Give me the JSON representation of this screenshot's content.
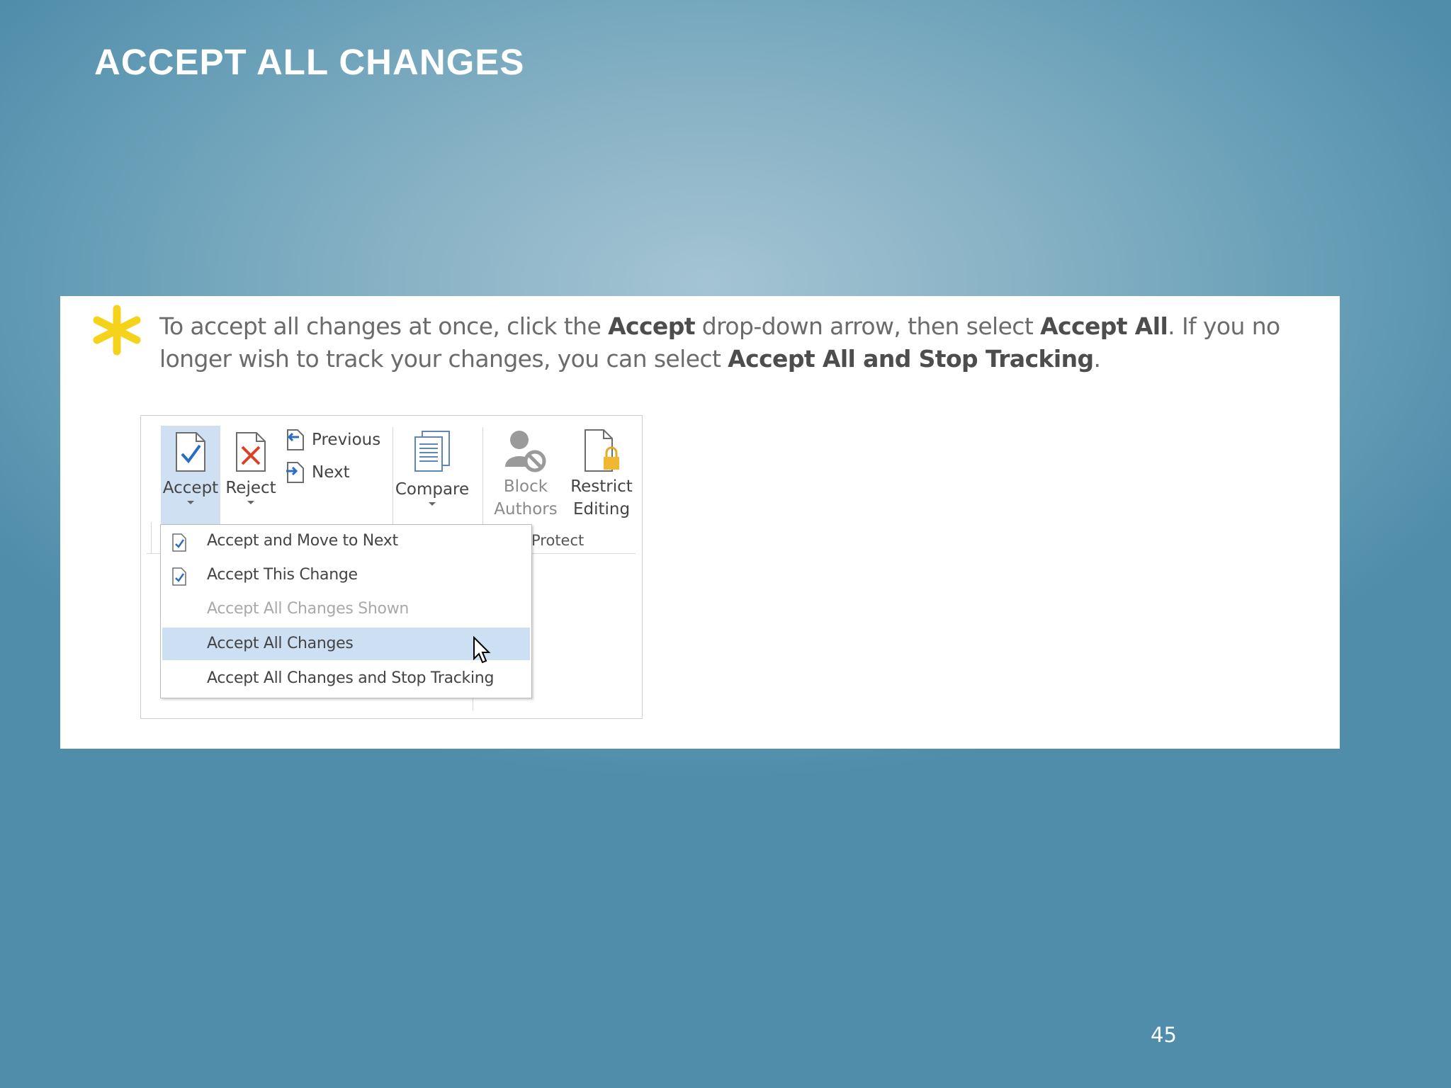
{
  "slide": {
    "title": "ACCEPT ALL CHANGES",
    "page_number": "45"
  },
  "tip": {
    "segments": [
      {
        "text": "To accept all changes at once, click the ",
        "bold": false
      },
      {
        "text": "Accept",
        "bold": true
      },
      {
        "text": " drop-down arrow, then select ",
        "bold": false
      },
      {
        "text": "Accept All",
        "bold": true
      },
      {
        "text": ". If you no longer wish to track your changes, you can select ",
        "bold": false
      },
      {
        "text": "Accept All and Stop Tracking",
        "bold": true
      },
      {
        "text": ".",
        "bold": false
      }
    ]
  },
  "ribbon": {
    "accept_label": "Accept",
    "reject_label": "Reject",
    "previous_label": "Previous",
    "next_label": "Next",
    "compare_label": "Compare",
    "block_label_1": "Block",
    "block_label_2": "Authors",
    "restrict_label_1": "Restrict",
    "restrict_label_2": "Editing",
    "protect_group": "Protect"
  },
  "menu": {
    "items": [
      {
        "label": "Accept and Move to Next",
        "icon": "accept-doc-icon",
        "state": "normal"
      },
      {
        "label": "Accept This Change",
        "icon": "accept-doc-icon",
        "state": "normal"
      },
      {
        "label": "Accept All Changes Shown",
        "icon": "",
        "state": "disabled"
      },
      {
        "label": "Accept All Changes",
        "icon": "",
        "state": "selected"
      },
      {
        "label": "Accept All Changes and Stop Tracking",
        "icon": "",
        "state": "normal"
      }
    ]
  },
  "colors": {
    "star": "#f4d31a",
    "menu_highlight": "#cddff3",
    "accept_highlight": "#cfe0f3",
    "check": "#2b6cc4",
    "reject_x": "#d9412b"
  }
}
